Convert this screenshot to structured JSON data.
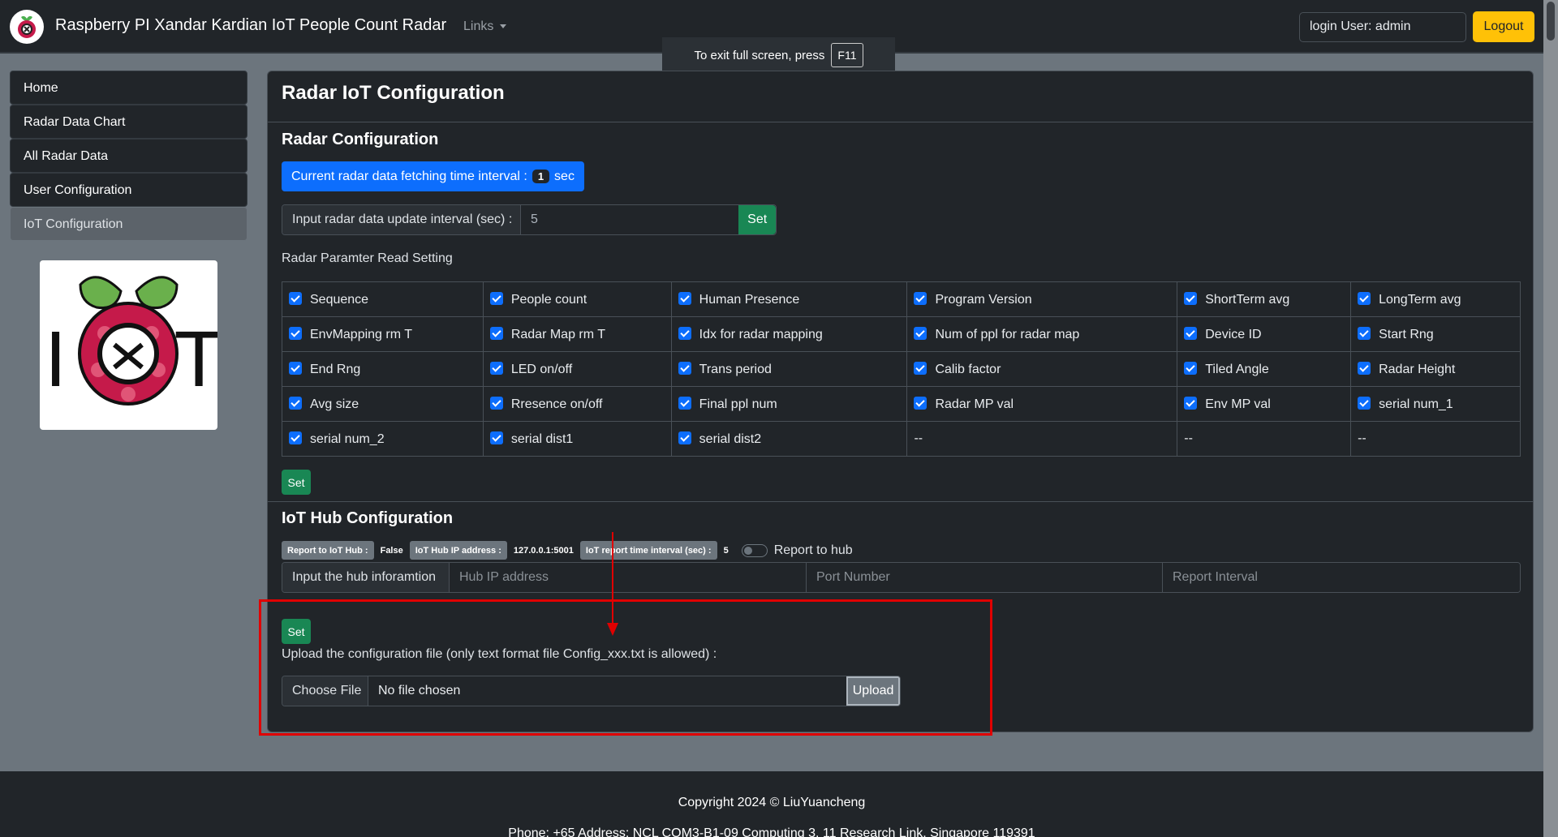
{
  "header": {
    "title": "Raspberry PI Xandar Kardian IoT People Count Radar",
    "links_label": "Links",
    "login_user": "login User: admin",
    "logout_label": "Logout"
  },
  "fullscreen_hint": {
    "text": "To exit full screen, press",
    "key": "F11"
  },
  "sidebar": {
    "items": [
      {
        "label": "Home"
      },
      {
        "label": "Radar Data Chart"
      },
      {
        "label": "All Radar Data"
      },
      {
        "label": "User Configuration"
      },
      {
        "label": "IoT Configuration"
      }
    ],
    "logo_text": "IOT"
  },
  "main": {
    "title": "Radar IoT Configuration",
    "radar_config": {
      "heading": "Radar Configuration",
      "interval_prefix": "Current radar data fetching time interval :",
      "interval_value": "1",
      "interval_unit": "sec",
      "update_label": "Input radar data update interval (sec) :",
      "update_value": "5",
      "set_label": "Set",
      "param_heading": "Radar Paramter Read Setting",
      "params": [
        [
          "Sequence",
          "People count",
          "Human Presence",
          "Program Version",
          "ShortTerm avg",
          "LongTerm avg"
        ],
        [
          "EnvMapping rm T",
          "Radar Map rm T",
          "Idx for radar mapping",
          "Num of ppl for radar map",
          "Device ID",
          "Start Rng"
        ],
        [
          "End Rng",
          "LED on/off",
          "Trans period",
          "Calib factor",
          "Tiled Angle",
          "Radar Height"
        ],
        [
          "Avg size",
          "Rresence on/off",
          "Final ppl num",
          "Radar MP val",
          "Env MP val",
          "serial num_1"
        ],
        [
          "serial num_2",
          "serial dist1",
          "serial dist2",
          "--",
          "--",
          "--"
        ]
      ],
      "params_set_label": "Set"
    },
    "hub_config": {
      "heading": "IoT Hub Configuration",
      "report_label": "Report to IoT Hub :",
      "report_value": "False",
      "ip_label": "IoT Hub IP address :",
      "ip_value": "127.0.0.1:5001",
      "interval_label": "IoT report time interval (sec) :",
      "interval_value": "5",
      "toggle_label": "Report to hub",
      "input_label": "Input the hub inforamtion",
      "ip_placeholder": "Hub IP address",
      "port_placeholder": "Port Number",
      "report_interval_placeholder": "Report Interval",
      "set_label": "Set",
      "upload_text": "Upload the configuration file (only text format file Config_xxx.txt is allowed) :",
      "choose_file_label": "Choose File",
      "no_file_text": "No file chosen",
      "upload_label": "Upload"
    }
  },
  "footer": {
    "copyright": "Copyright 2024 © LiuYuancheng",
    "contact": "Phone: +65 Address: NCL COM3-B1-09 Computing 3, 11 Research Link, Singapore 119391"
  },
  "colors": {
    "primary": "#0d6efd",
    "success": "#198754",
    "warning": "#ffc107",
    "annotation": "#e00000"
  }
}
